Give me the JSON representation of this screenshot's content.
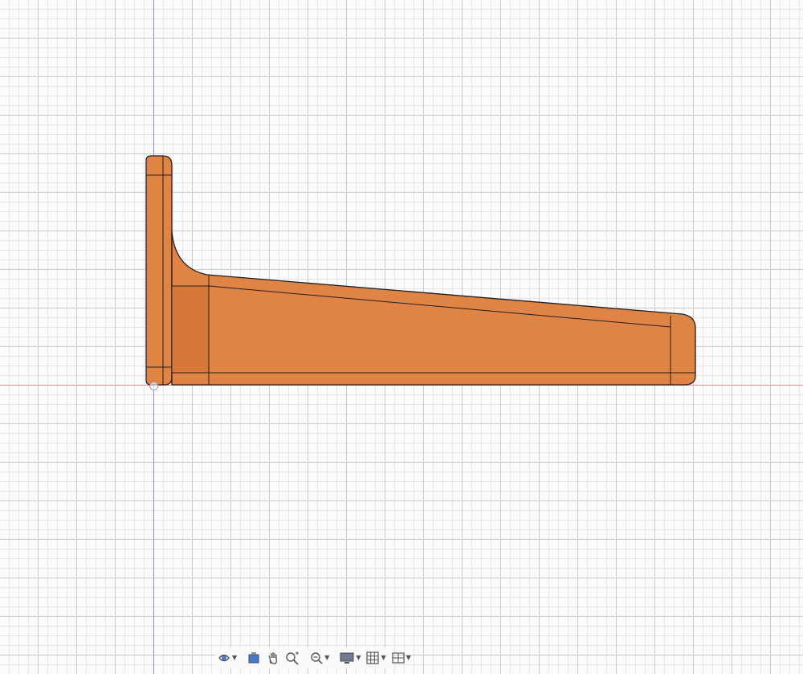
{
  "canvas": {
    "background_color": "#fbfbfb",
    "grid_major_color": "#c9cdd2",
    "grid_minor_color": "#e4e6e9",
    "axis_y_color": "#8d88e6",
    "axis_x_color": "#f08e8e"
  },
  "model": {
    "name": "bracket",
    "body_color": "#e08445",
    "shadow_color": "#c86a2d",
    "edge_color": "#1f1f1f"
  },
  "navbar": {
    "items": [
      {
        "icon": "orbit-icon",
        "has_menu": true
      },
      {
        "icon": "look-at-icon",
        "has_menu": false
      },
      {
        "icon": "pan-hand-icon",
        "has_menu": false
      },
      {
        "icon": "zoom-icon",
        "has_menu": false
      },
      {
        "icon": "fit-zoom-icon",
        "has_menu": true
      },
      {
        "icon": "display-settings-icon",
        "has_menu": true
      },
      {
        "icon": "grid-settings-icon",
        "has_menu": true
      },
      {
        "icon": "viewports-icon",
        "has_menu": true
      }
    ]
  }
}
